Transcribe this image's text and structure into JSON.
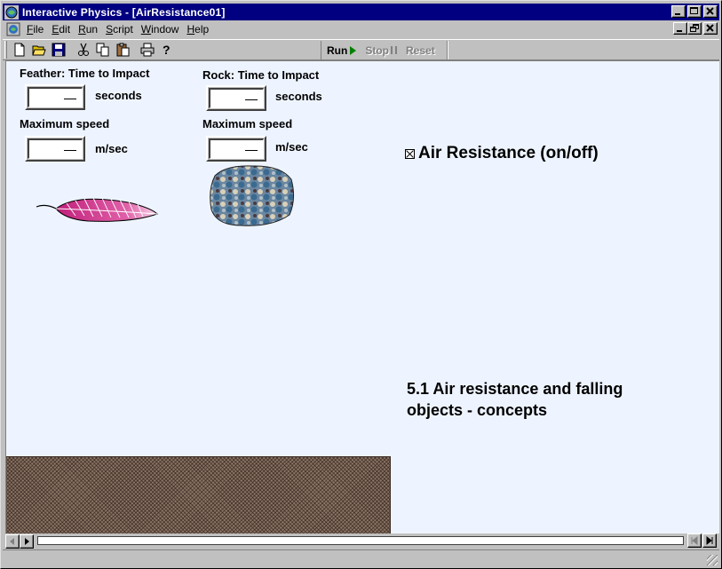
{
  "window": {
    "title": "Interactive Physics - [AirResistance01]"
  },
  "menubar": {
    "items": [
      {
        "accel": "F",
        "rest": "ile"
      },
      {
        "accel": "E",
        "rest": "dit"
      },
      {
        "accel": "R",
        "rest": "un"
      },
      {
        "accel": "S",
        "rest": "cript"
      },
      {
        "accel": "W",
        "rest": "indow"
      },
      {
        "accel": "H",
        "rest": "elp"
      }
    ]
  },
  "toolbar": {
    "icons": [
      "new-icon",
      "open-icon",
      "save-icon",
      "cut-icon",
      "copy-icon",
      "paste-icon",
      "print-icon",
      "help-icon"
    ],
    "run_label": "Run",
    "stop_label": "Stop",
    "reset_label": "Reset"
  },
  "feather": {
    "time_label": "Feather: Time to Impact",
    "time_unit": "seconds",
    "speed_label": "Maximum speed",
    "speed_unit": "m/sec"
  },
  "rock": {
    "time_label": "Rock: Time to Impact",
    "time_unit": "seconds",
    "speed_label": "Maximum speed",
    "speed_unit": "m/sec"
  },
  "air_resistance": {
    "label": "Air Resistance (on/off)",
    "checked": true
  },
  "caption": {
    "line1": "5.1 Air resistance and falling",
    "line2": "objects - concepts"
  },
  "colors": {
    "titlebar": "#000080",
    "workspace": "#eef4ff",
    "feather": "#d0408a",
    "run_arrow": "#008000"
  }
}
